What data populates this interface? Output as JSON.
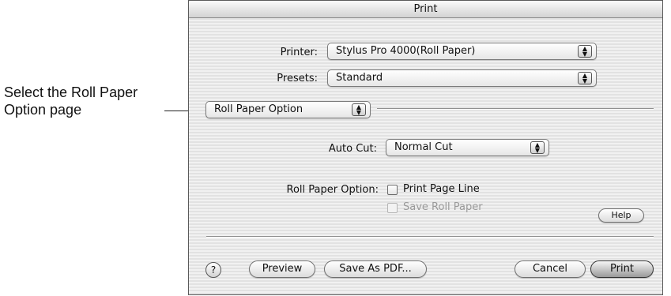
{
  "callout": {
    "line1": "Select the Roll Paper",
    "line2": "Option page"
  },
  "window": {
    "title": "Print"
  },
  "printer": {
    "label": "Printer:",
    "value": "Stylus Pro 4000(Roll Paper)"
  },
  "presets": {
    "label": "Presets:",
    "value": "Standard"
  },
  "pane": {
    "value": "Roll Paper Option"
  },
  "auto_cut": {
    "label": "Auto Cut:",
    "value": "Normal Cut"
  },
  "roll_paper_option": {
    "label": "Roll Paper Option:",
    "print_page_line": {
      "label": "Print Page Line",
      "checked": false
    },
    "save_roll_paper": {
      "label": "Save Roll Paper",
      "checked": false,
      "enabled": false
    }
  },
  "buttons": {
    "help": "Help",
    "help_icon": "?",
    "preview": "Preview",
    "save_as_pdf": "Save As PDF...",
    "cancel": "Cancel",
    "print": "Print"
  },
  "icons": {
    "popup_arrows": "up-down-arrows-icon",
    "help": "question-mark-icon"
  },
  "arrows_glyph": "▲\n▼"
}
